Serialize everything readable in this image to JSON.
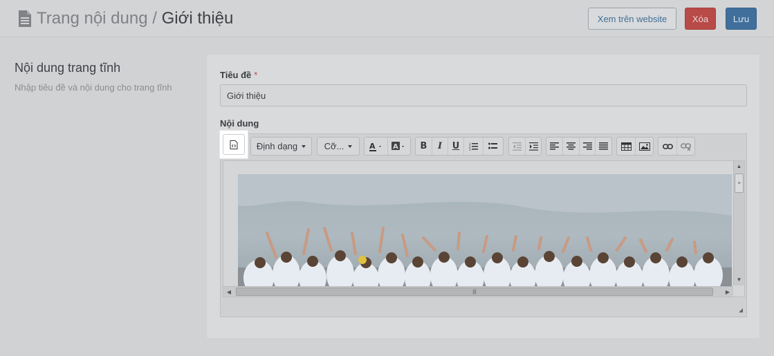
{
  "header": {
    "section": "Trang nội dung",
    "separator": " / ",
    "current": "Giới thiệu",
    "doc_icon": "file-text-icon",
    "buttons": {
      "view_label": "Xem trên website",
      "delete_label": "Xóa",
      "save_label": "Lưu"
    }
  },
  "sidebar": {
    "title": "Nội dung trang tĩnh",
    "description": "Nhập tiêu đề và nội dung cho trang tĩnh"
  },
  "form": {
    "title_label": "Tiêu đề",
    "required_mark": "*",
    "title_value": "Giới thiệu",
    "content_label": "Nội dung"
  },
  "editor": {
    "toolbar": {
      "source_icon": "code-view-icon",
      "format_label": "Định dạng",
      "size_label": "Cỡ...",
      "icons": [
        "font-color-icon",
        "background-color-icon",
        "bold-icon",
        "italic-icon",
        "underline-icon",
        "ordered-list-icon",
        "unordered-list-icon",
        "outdent-icon",
        "indent-icon",
        "align-left-icon",
        "align-center-icon",
        "align-right-icon",
        "justify-icon",
        "table-icon",
        "image-icon",
        "link-icon",
        "unlink-icon"
      ]
    },
    "content_image": "group-photo-image"
  },
  "colors": {
    "delete": "#b84a47",
    "save": "#3f6f9a",
    "highlight": "#ffffff"
  }
}
